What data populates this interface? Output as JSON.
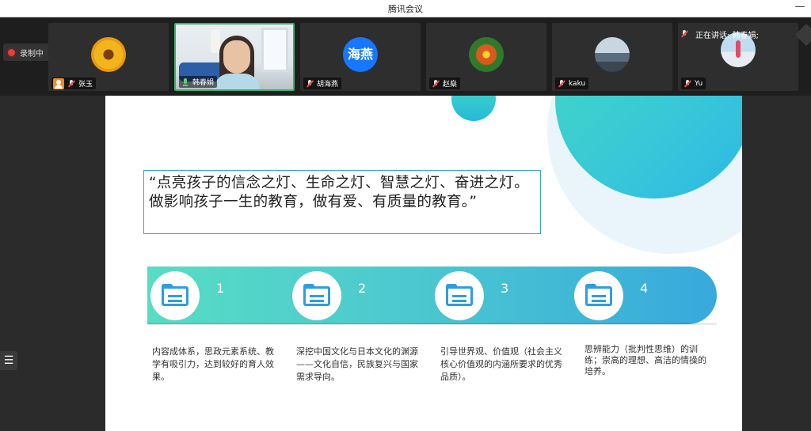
{
  "app": {
    "title": "腾讯会议",
    "minimize_label": "—"
  },
  "recording": {
    "label": "录制中"
  },
  "participants": [
    {
      "name": "张玉",
      "avatar": "sunflower"
    },
    {
      "name": "韩春娟",
      "avatar": "video"
    },
    {
      "name": "胡海燕",
      "avatar_text": "海燕"
    },
    {
      "name": "赵燊",
      "avatar": "flower"
    },
    {
      "name": "kaku",
      "avatar": "dock"
    },
    {
      "name": "Yu",
      "avatar": "girl"
    }
  ],
  "speaking": {
    "label": "正在讲话: 韩春娟;"
  },
  "sidebar": {
    "toggle_glyph": "☰"
  },
  "slide": {
    "quote": "“点亮孩子的信念之灯、生命之灯、智慧之灯、奋进之灯。做影响孩子一生的教育，做有爱、有质量的教育。”",
    "steps": [
      {
        "number": "1",
        "text": "内容成体系，思政元素系统、教学有吸引力，达到较好的育人效果。"
      },
      {
        "number": "2",
        "text": "深挖中国文化与日本文化的渊源——文化自信，民族复兴与国家需求导向。"
      },
      {
        "number": "3",
        "text": "引导世界观、价值观（社会主义核心价值观的内涵所要求的优秀品质）。"
      },
      {
        "number": "4",
        "text": "思辨能力（批判性思维）的训练；崇高的理想、高洁的情操的培养。"
      }
    ]
  },
  "colors": {
    "accent_green": "#38b36b",
    "teal": "#58dcc4",
    "blue": "#37a9dd",
    "record_red": "#e8403a"
  }
}
